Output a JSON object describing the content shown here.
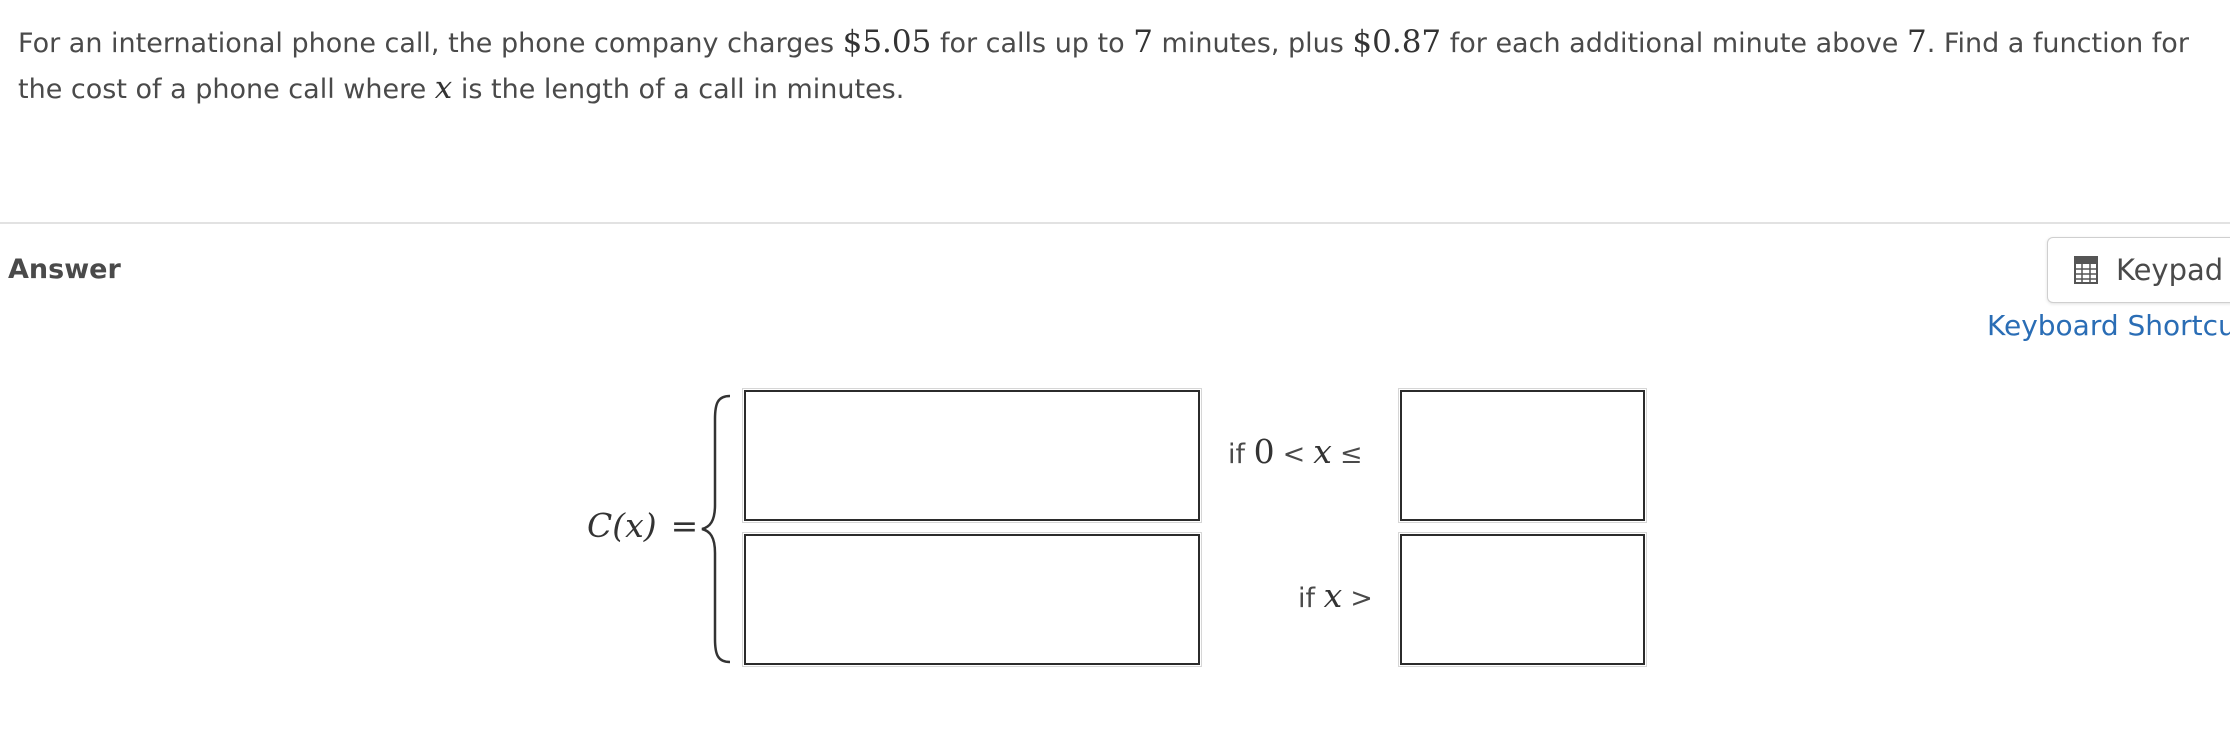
{
  "question": {
    "seg1": "For an international phone call, the phone company charges ",
    "price_base": "$5.05",
    "seg2": " for calls up to ",
    "minutes_base": "7",
    "seg3": " minutes, plus ",
    "price_extra": "$0.87",
    "seg4": " for each additional minute above ",
    "minutes_above": "7",
    "seg5": ".  Find a function for the cost of a phone call where ",
    "variable": "x",
    "seg6": " is the length of a call in minutes."
  },
  "answer": {
    "heading": "Answer",
    "keypad_label": "Keypad",
    "keypad_icon": "calculator-icon",
    "shortcuts_link": "Keyboard Shortcuts"
  },
  "piecewise": {
    "function_name": "C(x)",
    "equals": "=",
    "case1": {
      "if_word": "if",
      "lower_value": "0",
      "less_than": "<",
      "variable": "x",
      "less_equal": "≤",
      "expression_value": "",
      "bound_value": ""
    },
    "case2": {
      "if_word": "if",
      "variable": "x",
      "greater_than": ">",
      "expression_value": "",
      "bound_value": ""
    }
  },
  "colors": {
    "text": "#4a4a4a",
    "link": "#2a6db5",
    "divider": "#e2e2e2",
    "box_border": "#2b2b2b"
  }
}
